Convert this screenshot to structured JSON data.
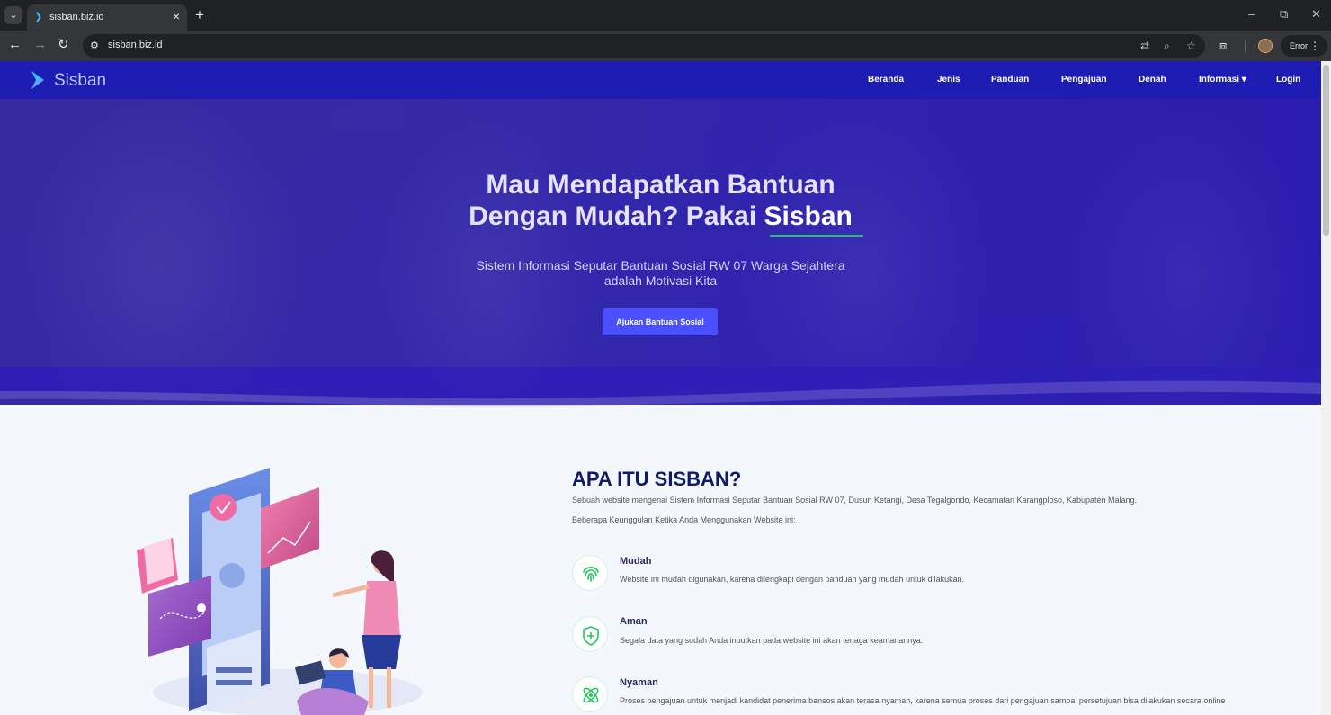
{
  "browser": {
    "tab_title": "sisban.biz.id",
    "url": "sisban.biz.id",
    "error_label": "Error"
  },
  "site": {
    "brand": "Sisban",
    "nav": [
      "Beranda",
      "Jenis",
      "Panduan",
      "Pengajuan",
      "Denah",
      "Informasi ▾",
      "Login"
    ]
  },
  "hero": {
    "title_line1": "Mau Mendapatkan Bantuan",
    "title_line2_prefix": "Dengan Mudah? Pakai ",
    "title_highlight": "Sisban",
    "subtitle_line1": "Sistem Informasi Seputar Bantuan Sosial RW 07 Warga Sejahtera",
    "subtitle_line2": "adalah Motivasi Kita",
    "cta": "Ajukan Bantuan Sosial"
  },
  "about": {
    "title": "APA ITU SISBAN?",
    "description": "Sebuah website mengenai Sistem Informasi Seputar Bantuan Sosial RW 07, Dusun Ketangi, Desa Tegalgondo, Kecamatan Karangploso, Kabupaten Malang.",
    "lead": "Beberapa Keunggulan Ketika Anda Menggunakan Website ini:",
    "features": [
      {
        "title": "Mudah",
        "desc": "Website ini mudah digunakan, karena dilengkapi dengan panduan yang mudah untuk dilakukan.",
        "icon": "fingerprint-icon"
      },
      {
        "title": "Aman",
        "desc": "Segala data yang sudah Anda inputkan pada website ini akan terjaga keamanannya.",
        "icon": "shield-icon"
      },
      {
        "title": "Nyaman",
        "desc": "Proses pengajuan untuk menjadi kandidat penerima bansos akan terasa nyaman, karena semua proses dari pengajuan sampai persetujuan bisa dilakukan secara online",
        "icon": "atom-icon"
      }
    ]
  },
  "colors": {
    "nav_bg": "#1d1db4",
    "cta_bg": "#4a50ff",
    "accent_green": "#22c55e",
    "heading_dark": "#0f1a6b"
  }
}
